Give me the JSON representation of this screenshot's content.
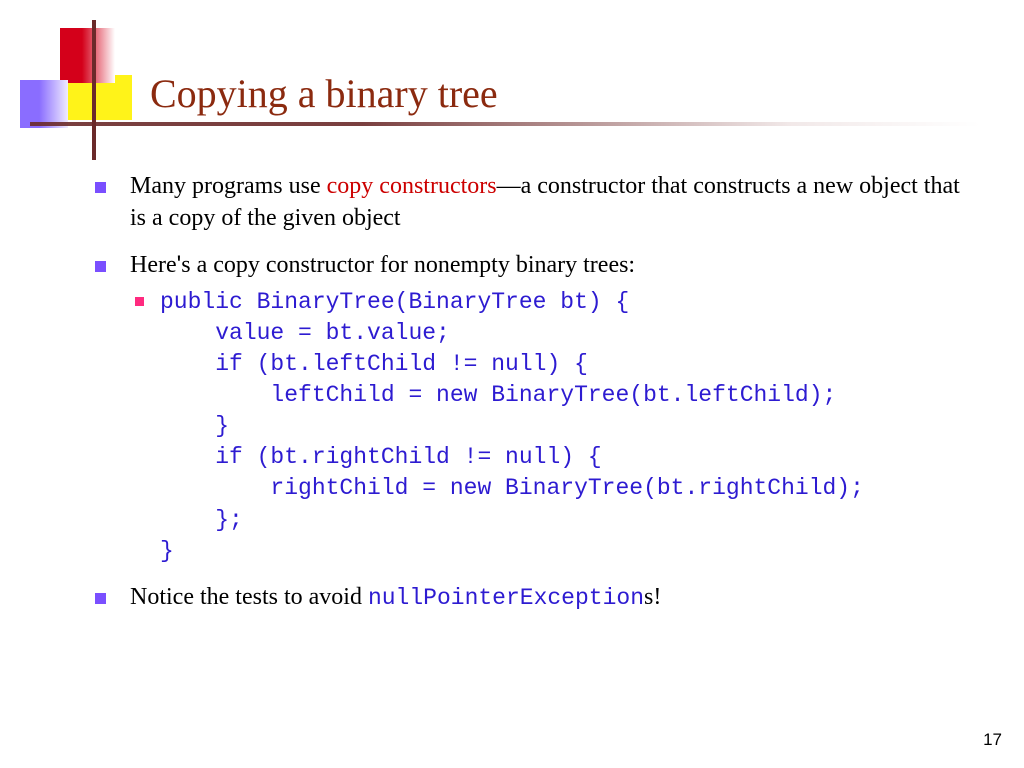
{
  "title": "Copying a binary tree",
  "bullets": {
    "b1_pre": "Many programs use ",
    "b1_hl": "copy constructors",
    "b1_post": "—a constructor that constructs a new object that is a copy of the given object",
    "b2_pre": "Here",
    "b2_apos": "'",
    "b2_post": "s a copy constructor for nonempty binary trees:",
    "code": "public BinaryTree(BinaryTree bt) {\n    value = bt.value;\n    if (bt.leftChild != null) {\n        leftChild = new BinaryTree(bt.leftChild);\n    }\n    if (bt.rightChild != null) {\n        rightChild = new BinaryTree(bt.rightChild);\n    };\n}",
    "b3_pre": "Notice the tests to avoid ",
    "b3_code": "nullPointerException",
    "b3_post": "s!"
  },
  "page": "17"
}
